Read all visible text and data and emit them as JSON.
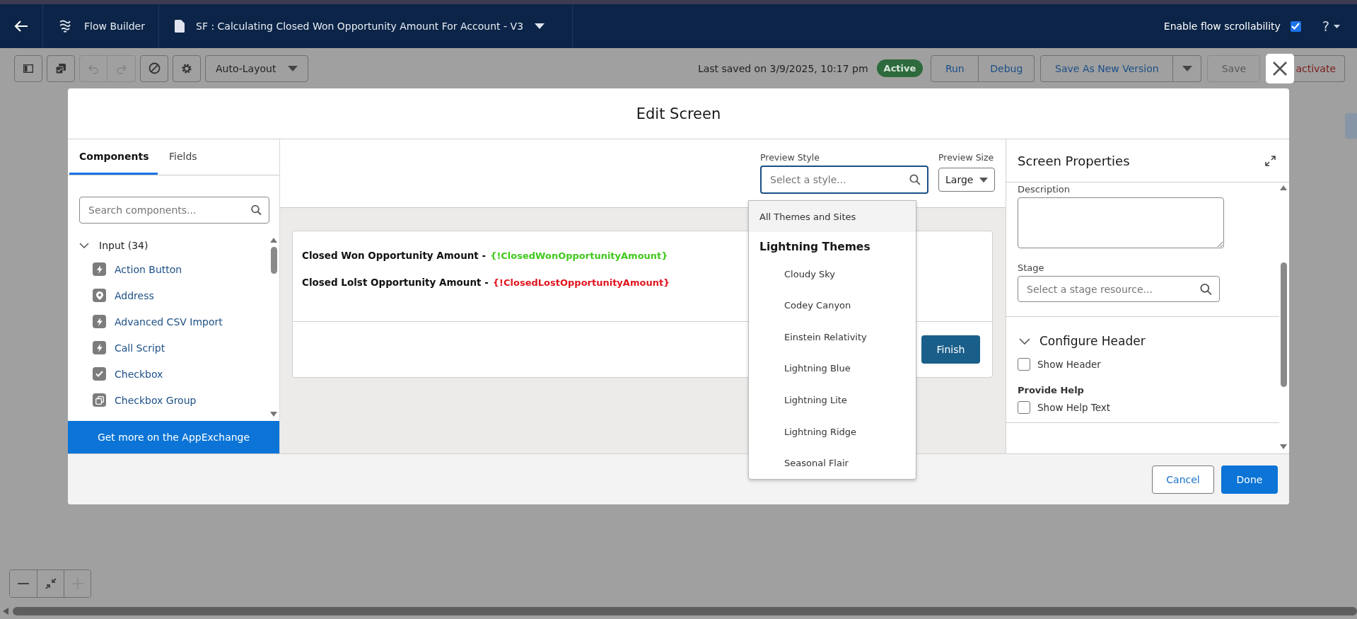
{
  "header": {
    "app_name": "Flow Builder",
    "flow_title": "SF : Calculating Closed Won Opportunity Amount For Account - V3",
    "scroll_toggle": {
      "label": "Enable flow scrollability",
      "checked": true
    },
    "help": "?"
  },
  "toolbar": {
    "undo_disabled": true,
    "layout_select": "Auto-Layout",
    "last_saved": "Last saved on 3/9/2025, 10:17 pm",
    "status": "Active",
    "run_debug": [
      "Run",
      "Debug"
    ],
    "save_as_new": "Save As New Version",
    "save": {
      "label": "Save",
      "disabled": true
    },
    "deactivate": "activate"
  },
  "modal": {
    "title": "Edit Screen",
    "palette": {
      "tabs": [
        {
          "label": "Components",
          "selected": true
        },
        {
          "label": "Fields",
          "selected": false
        }
      ],
      "search_placeholder": "Search components...",
      "group": {
        "label": "Input (34)",
        "expanded": true,
        "items": [
          {
            "label": "Action Button",
            "kind": "action"
          },
          {
            "label": "Address",
            "kind": "location"
          },
          {
            "label": "Advanced CSV Import",
            "kind": "action"
          },
          {
            "label": "Call Script",
            "kind": "action"
          },
          {
            "label": "Checkbox",
            "kind": "checkbox"
          },
          {
            "label": "Checkbox Group",
            "kind": "group"
          }
        ]
      },
      "footer_link": "Get more on the AppExchange"
    },
    "preview": {
      "style": {
        "label": "Preview Style",
        "placeholder": "Select a style..."
      },
      "size": {
        "label": "Preview Size",
        "value": "Large"
      },
      "style_options": [
        {
          "label": "All Themes and Sites",
          "kind": "option",
          "selected": true
        },
        {
          "label": "Lightning Themes",
          "kind": "heading",
          "selected": false
        },
        {
          "label": "Cloudy Sky",
          "kind": "sub",
          "selected": false
        },
        {
          "label": "Codey Canyon",
          "kind": "sub",
          "selected": false
        },
        {
          "label": "Einstein Relativity",
          "kind": "sub",
          "selected": false
        },
        {
          "label": "Lightning Blue",
          "kind": "sub",
          "selected": false
        },
        {
          "label": "Lightning Lite",
          "kind": "sub",
          "selected": false
        },
        {
          "label": "Lightning Ridge",
          "kind": "sub",
          "selected": false
        },
        {
          "label": "Seasonal Flair",
          "kind": "sub",
          "selected": false
        }
      ]
    },
    "canvas_card": {
      "lines": [
        {
          "label": "Closed Won Opportunity Amount -",
          "variable": "{!ClosedWonOpportunityAmount}",
          "color": "#41c91e"
        },
        {
          "label": "Closed Lolst Opportunity Amount -",
          "variable": "{!ClosedLostOpportunityAmount}",
          "color": "#e0141e"
        }
      ],
      "button": "Finish"
    },
    "properties": {
      "title": "Screen Properties",
      "description_label": "Description",
      "stage_label": "Stage",
      "stage_placeholder": "Select a stage resource...",
      "section": {
        "label": "Configure Header",
        "expanded": true
      },
      "show_header": {
        "label": "Show Header",
        "checked": false
      },
      "help_heading": "Provide Help",
      "show_help": {
        "label": "Show Help Text",
        "checked": false
      }
    },
    "footer": {
      "cancel": "Cancel",
      "done": "Done"
    }
  },
  "canvas": {
    "zoom_controls": [
      {
        "kind": "minus",
        "disabled": false
      },
      {
        "kind": "fit",
        "disabled": false
      },
      {
        "kind": "plus",
        "disabled": true
      }
    ]
  }
}
